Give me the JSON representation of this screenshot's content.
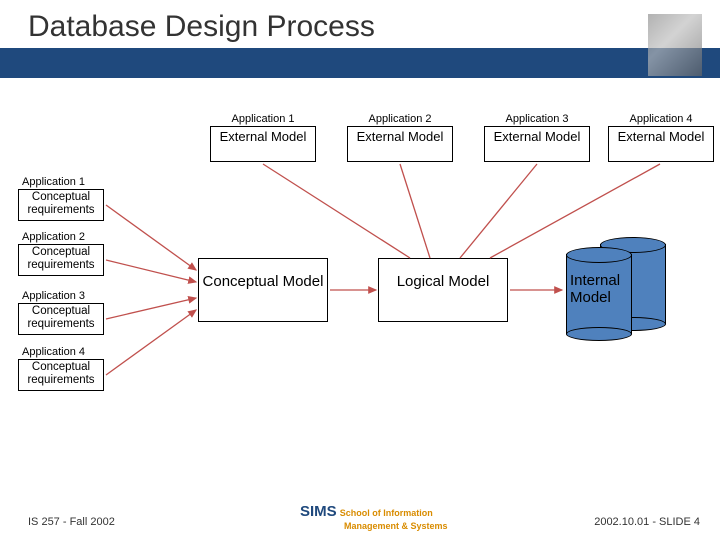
{
  "title": "Database Design Process",
  "external": {
    "apps": [
      "Application 1",
      "Application 2",
      "Application 3",
      "Application 4"
    ],
    "box_label": "External Model"
  },
  "requirements": {
    "apps": [
      "Application 1",
      "Application 2",
      "Application 3",
      "Application 4"
    ],
    "box_label": "Conceptual requirements"
  },
  "models": {
    "conceptual": "Conceptual Model",
    "logical": "Logical Model",
    "internal": "Internal Model"
  },
  "footer": {
    "left": "IS 257 - Fall 2002",
    "center_prefix": "SIMS",
    "center_line1": "School of Information",
    "center_line2": "Management & Systems",
    "right": "2002.10.01 - SLIDE 4"
  }
}
